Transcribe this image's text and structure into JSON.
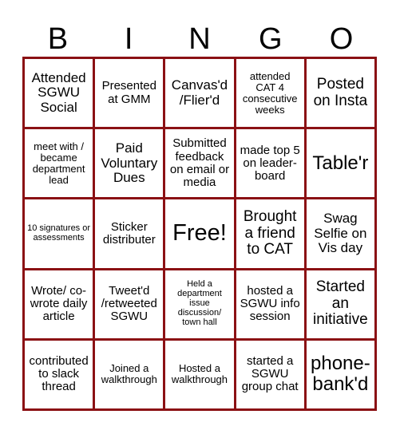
{
  "header": {
    "letters": [
      "B",
      "I",
      "N",
      "G",
      "O"
    ]
  },
  "colors": {
    "grid_border": "#8b1114",
    "background": "#ffffff",
    "text": "#000000"
  },
  "rows": [
    [
      "Attended SGWU Social",
      "Presented at GMM",
      "Canvas'd /Flier'd",
      "attended CAT 4 consecutive weeks",
      "Posted on Insta"
    ],
    [
      "meet with / became department lead",
      "Paid Voluntary Dues",
      "Submitted feedback on email or media",
      "made top 5 on leader-board",
      "Table'r"
    ],
    [
      "10 signatures or assessments",
      "Sticker distributer",
      "Free!",
      "Brought a friend to CAT",
      "Swag Selfie on Vis day"
    ],
    [
      "Wrote/ co-wrote daily article",
      "Tweet'd /retweeted SGWU",
      "Held a department issue discussion/ town hall",
      "hosted a SGWU info session",
      "Started an initiative"
    ],
    [
      "contributed to slack thread",
      "Joined a walkthrough",
      "Hosted a walkthrough",
      "started a SGWU group chat",
      "phone-bank'd"
    ]
  ]
}
